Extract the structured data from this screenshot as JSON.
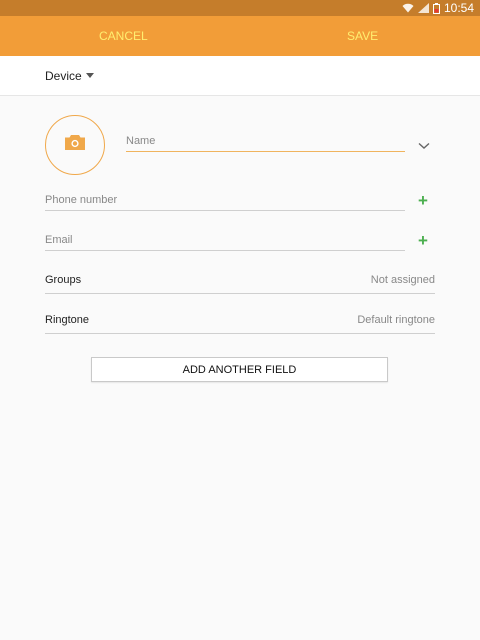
{
  "status_bar": {
    "time": "10:54"
  },
  "action_bar": {
    "cancel_label": "CANCEL",
    "save_label": "SAVE"
  },
  "storage": {
    "label": "Device"
  },
  "fields": {
    "name_placeholder": "Name",
    "phone_placeholder": "Phone number",
    "email_placeholder": "Email"
  },
  "rows": {
    "groups_label": "Groups",
    "groups_value": "Not assigned",
    "ringtone_label": "Ringtone",
    "ringtone_value": "Default ringtone"
  },
  "add_field_label": "ADD ANOTHER FIELD",
  "colors": {
    "action_bar": "#f29d38",
    "status_bar": "#c57d2b",
    "action_text": "#ffee70",
    "add_icon": "#4caf50"
  },
  "icons": [
    "wifi-icon",
    "signal-icon",
    "battery-icon",
    "camera-icon",
    "chevron-down-icon",
    "plus-icon"
  ]
}
